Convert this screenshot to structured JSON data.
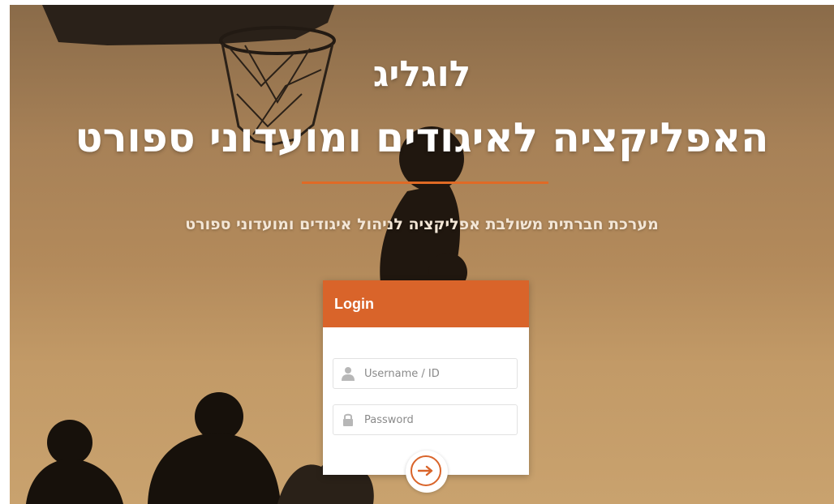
{
  "hero": {
    "title_line_1": "לוגליג",
    "title_line_2": "האפליקציה לאיגודים ומועדוני ספורט",
    "subtitle": "מערכת חברתית משולבת אפליקציה לניהול איגודים ומועדוני ספורט"
  },
  "login": {
    "header": "Login",
    "username_placeholder": "Username / ID",
    "password_placeholder": "Password",
    "submit_icon": "arrow-right-icon"
  },
  "colors": {
    "accent": "#d9642a",
    "background": "#b38a5b",
    "title": "#ffffff"
  },
  "icons": {
    "username": "user-icon",
    "password": "lock-icon",
    "submit": "arrow-right-icon"
  }
}
